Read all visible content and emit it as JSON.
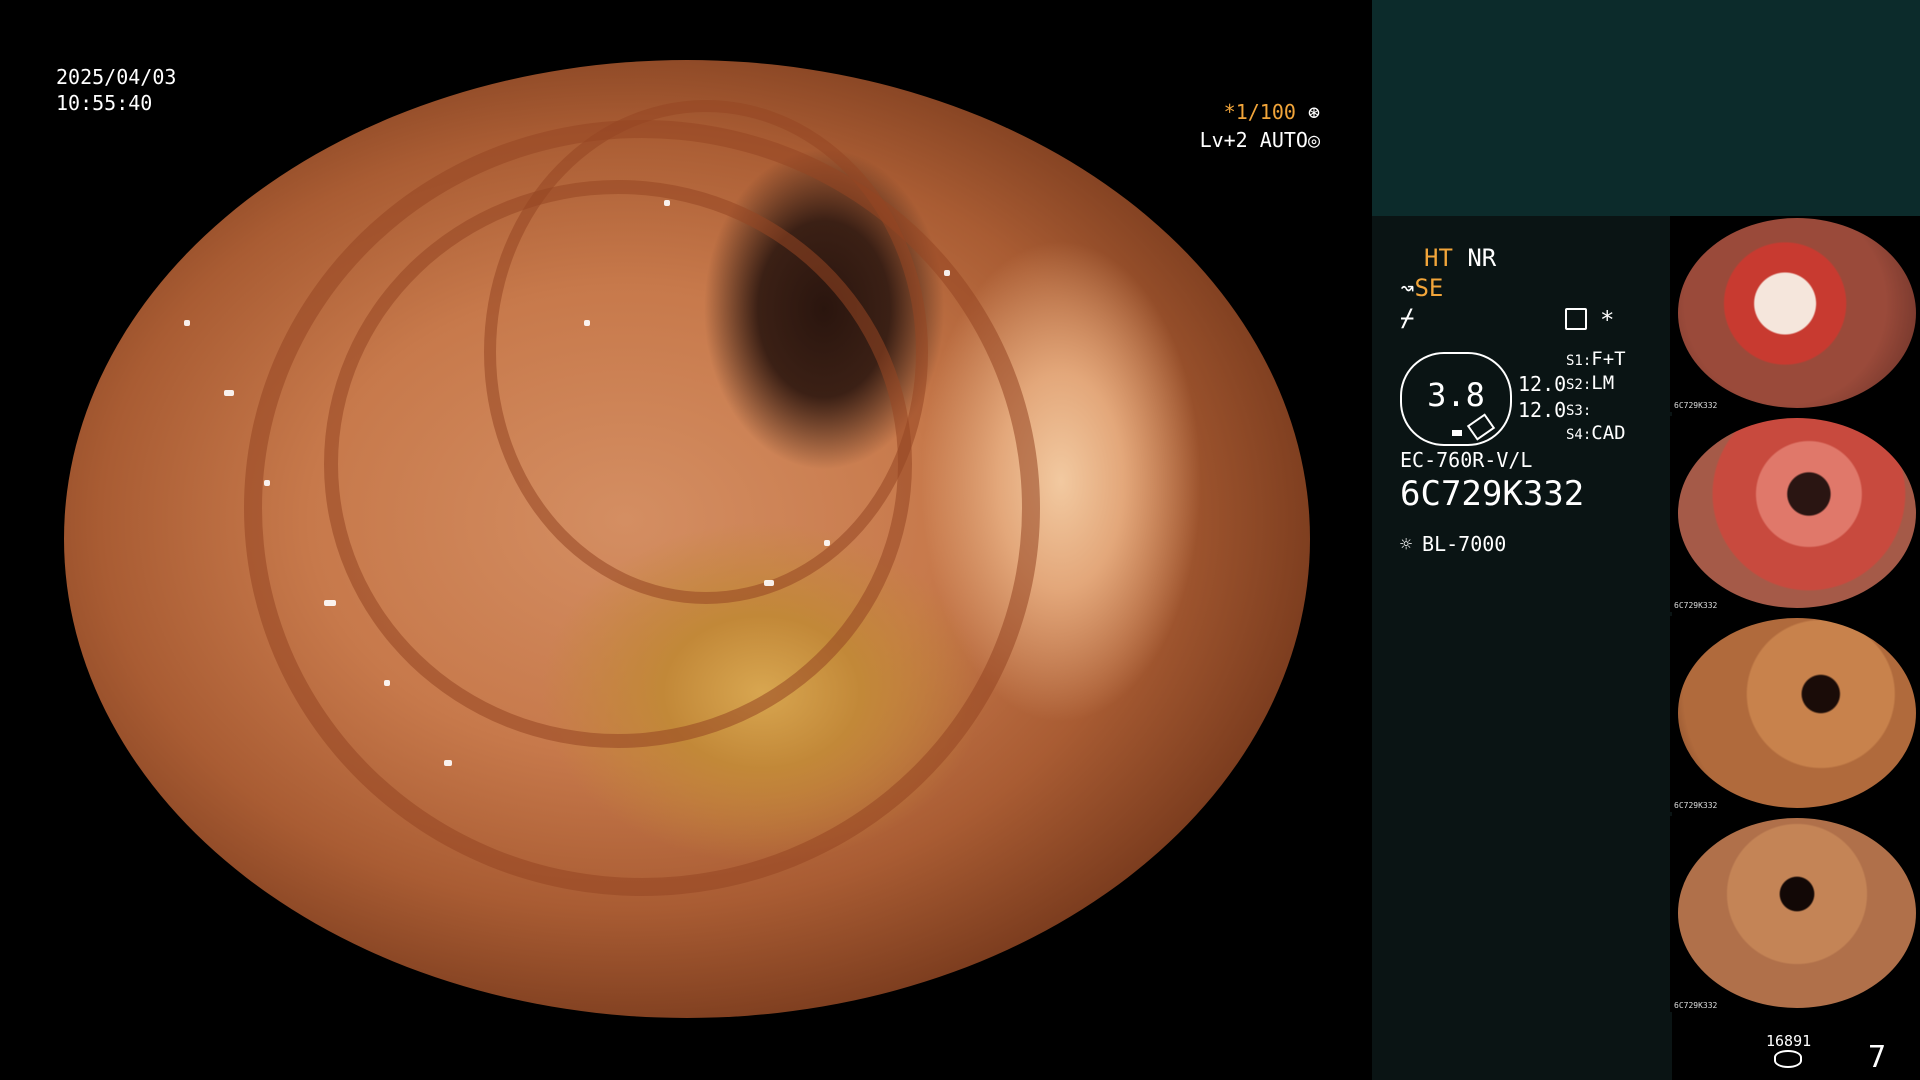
{
  "timestamp": {
    "date": "2025/04/03",
    "time": "10:55:40"
  },
  "overlay": {
    "shutter": "*1/100",
    "level": "Lv+2",
    "mode": "AUTO"
  },
  "panel": {
    "ht": "HT",
    "nr": "NR",
    "se": "SE",
    "gauge_value": "3.8",
    "twelve_a": "12.0",
    "twelve_b": "12.0",
    "s1": {
      "key": "S1:",
      "val": "F+T"
    },
    "s2": {
      "key": "S2:",
      "val": "LM"
    },
    "s3": {
      "key": "S3:",
      "val": ""
    },
    "s4": {
      "key": "S4:",
      "val": "CAD"
    },
    "model": "EC-760R-V/L",
    "serial": "6C729K332",
    "lamp": "BL-7000"
  },
  "thumbnails": [
    {
      "caption": "6C729K332"
    },
    {
      "caption": "6C729K332"
    },
    {
      "caption": "6C729K332"
    },
    {
      "caption": "6C729K332"
    }
  ],
  "footer": {
    "count": "16891",
    "page": "7"
  },
  "colors": {
    "accent_orange": "#f2a53a",
    "panel_teal": "#0c2b2b"
  }
}
